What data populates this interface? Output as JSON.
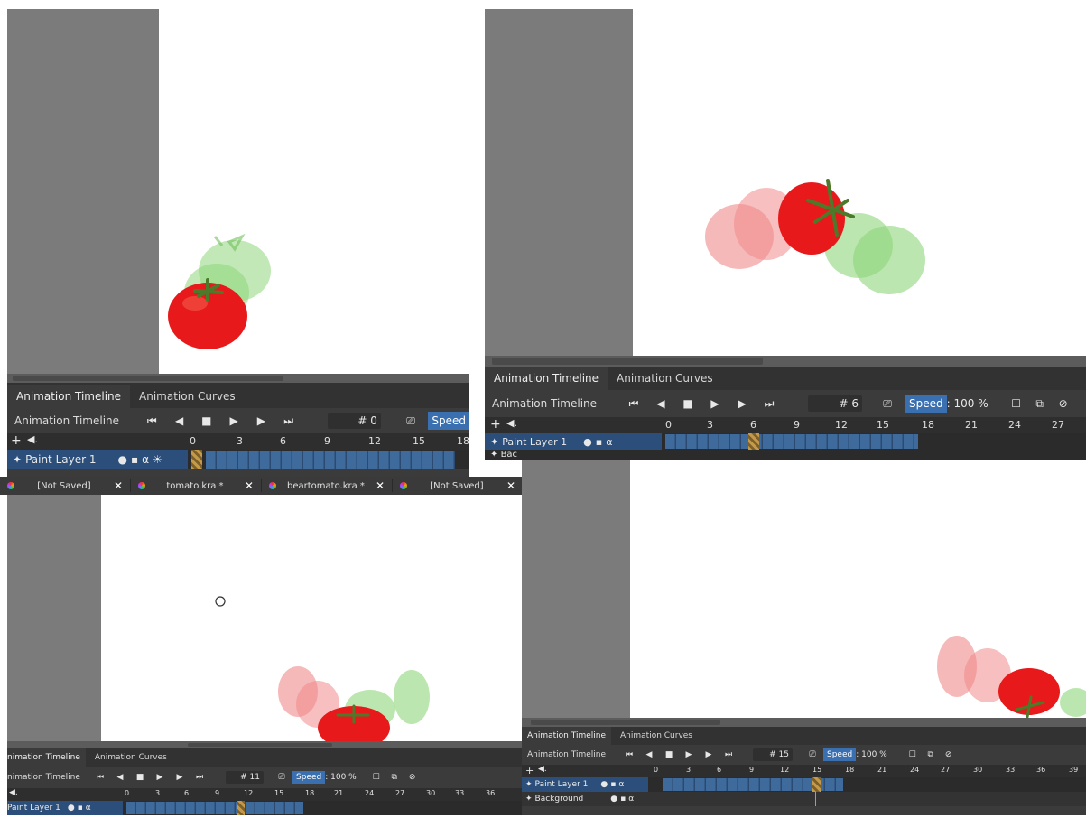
{
  "panels": {
    "top_left": {
      "tabs": [
        "Animation Timeline",
        "Animation Curves"
      ],
      "header_title": "Animation Timeline",
      "frame": "# 0",
      "speed": "Speed",
      "ruler": [
        "0",
        "3",
        "6",
        "9",
        "12",
        "15",
        "18"
      ],
      "layers": [
        "Paint Layer 1"
      ]
    },
    "top_right": {
      "tabs": [
        "Animation Timeline",
        "Animation Curves"
      ],
      "header_title": "Animation Timeline",
      "frame": "# 6",
      "speed_label": "Speed",
      "speed_value": ": 100 %",
      "ruler": [
        "0",
        "3",
        "6",
        "9",
        "12",
        "15",
        "18",
        "21",
        "24",
        "27"
      ],
      "layers": [
        "Paint Layer 1",
        "Bac"
      ]
    },
    "bottom_left": {
      "doc_tabs": [
        "[Not Saved]",
        "tomato.kra *",
        "beartomato.kra *",
        "[Not Saved]"
      ],
      "tabs": [
        "nimation Timeline",
        "Animation Curves"
      ],
      "header_title": "nimation Timeline",
      "frame": "# 11",
      "speed_label": "Speed",
      "speed_value": ": 100 %",
      "ruler": [
        "0",
        "3",
        "6",
        "9",
        "12",
        "15",
        "18",
        "21",
        "24",
        "27",
        "30",
        "33",
        "36"
      ],
      "layers": [
        "Paint Layer 1"
      ]
    },
    "bottom_right": {
      "tabs": [
        "Animation Timeline",
        "Animation Curves"
      ],
      "header_title": "Animation Timeline",
      "frame": "# 15",
      "speed_label": "Speed",
      "speed_value": ": 100 %",
      "ruler": [
        "0",
        "3",
        "6",
        "9",
        "12",
        "15",
        "18",
        "21",
        "24",
        "27",
        "30",
        "33",
        "36",
        "39"
      ],
      "layers": [
        "Paint Layer 1",
        "Background"
      ]
    }
  },
  "icons": {
    "first_frame": "first-frame-icon",
    "prev_frame": "previous-frame-icon",
    "stop": "stop-icon",
    "play": "play-icon",
    "next_frame": "next-frame-icon",
    "last_frame": "last-frame-icon",
    "drop_frames": "drop-frames-icon",
    "add": "add-icon",
    "audio": "audio-icon"
  },
  "colors": {
    "tomato_red": "#e8191b",
    "tomato_red_onion": "#f08a8a",
    "tomato_green_onion": "#8ed67a",
    "stem": "#4d7a2a",
    "panel_bg": "#3b3b3b",
    "speed_accent": "#3a6fb0",
    "playhead": "#c49a4a"
  }
}
